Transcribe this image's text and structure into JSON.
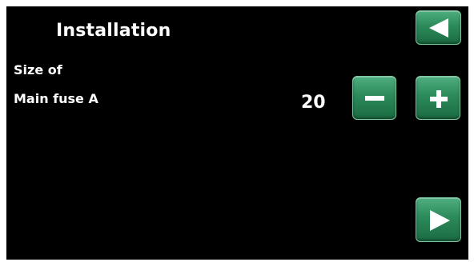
{
  "header": {
    "title": "Installation"
  },
  "setting": {
    "label_line1": "Size of",
    "label_line2": "Main fuse A",
    "value": "20"
  },
  "icons": {
    "back": "back-arrow-icon",
    "minus": "minus-icon",
    "plus": "plus-icon",
    "forward": "forward-arrow-icon"
  },
  "colors": {
    "background": "#000000",
    "button_green": "#2c8a5a",
    "text": "#ffffff"
  }
}
